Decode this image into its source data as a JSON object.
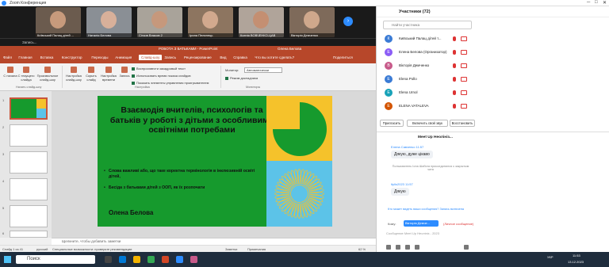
{
  "window": {
    "title": "Zoom Конференция"
  },
  "participants_stripe": [
    {
      "name": "Київський Палац дітей ...",
      "face": "#c79a7c",
      "bg": "#6b5b4e"
    },
    {
      "name": "Наталія Белова",
      "face": "#d8b09a",
      "bg": "#8a8f95"
    },
    {
      "name": "Сітков Власов 2",
      "face": "#c6987c",
      "bg": "#a9a39a"
    },
    {
      "name": "Ірина Пелипець",
      "face": "#d2a98e",
      "bg": "#8d7560"
    },
    {
      "name": "Ксенія ВОВЧЕНКО-ЦАВ",
      "face": "#c48f72",
      "bg": "#b0a49a"
    },
    {
      "name": "Вікторія Демченко",
      "face": "#cfa88c",
      "bg": "#7e6a5a"
    }
  ],
  "share": {
    "label": "Запись..."
  },
  "ppt": {
    "doc_title": "РОБОТА З БАТЬКАМИ - PowerPoint",
    "user": "Олена Белова",
    "share_btn": "Поделиться",
    "tabs": [
      "Файл",
      "Главная",
      "Вставка",
      "Конструктор",
      "Переходы",
      "Анимация",
      "Слайд-шоу",
      "Запись",
      "Рецензирование",
      "Вид",
      "Справка",
      "Что вы хотите сделать?"
    ],
    "active_tab": "Слайд-шоу",
    "ribbon": {
      "btn_start": "С начала",
      "btn_current": "С текущего слайда",
      "btn_custom": "Произвольное слайд-шоу",
      "group1": "Начать слайд-шоу",
      "btn_setup": "Настройка слайд-шоу",
      "btn_hide": "Скрыть слайд",
      "btn_rehearse": "Настройка времени",
      "btn_record": "Запись",
      "chk1": "Воспроизвести закадровый текст",
      "chk2": "Использовать время показа слайдов",
      "chk3": "Показать элементы управления проигрывателем",
      "group2": "Настройка",
      "monitor_label": "Монитор:",
      "monitor_value": "Автоматически",
      "presenter": "Режим докладчика",
      "group3": "Мониторы"
    },
    "slide": {
      "title": "Взаємодія вчителів, психологів та батьків у роботі з дітьми з особливими освітніми потребами",
      "bullets": [
        "Слова важливі або, що таке коректна термінологія в інклюзивній освіті дітей,",
        "Бесіда з батьками дітей з ООП, як їх розпочати"
      ],
      "author": "Олена Белова",
      "green": "#169a2d",
      "yellow": "#f5c22b",
      "blue": "#5cc3e8"
    },
    "thumb_numbers": [
      "1",
      "2",
      "3",
      "4",
      "5",
      "6"
    ],
    "notes_placeholder": "Щелкните, чтобы добавить заметки",
    "status": {
      "slide": "Слайд 1 из 41",
      "lang": "русский",
      "accessibility": "Специальные возможности: проверьте рекомендации",
      "notes": "Заметки",
      "comments": "Примечания",
      "zoom": "62 %"
    }
  },
  "panel": {
    "title": "Участники (72)",
    "search_placeholder": "Найти участника",
    "people": [
      {
        "initial": "К",
        "name": "Київський Палац дітей т...",
        "color": "#3a7bd5"
      },
      {
        "initial": "Е",
        "name": "Елена Белова (Организатор)",
        "color": "#8b5cf6"
      },
      {
        "initial": "В",
        "name": "Вікторія Демченко",
        "color": "#c75a8a"
      },
      {
        "initial": "E",
        "name": "Elena Pollo",
        "color": "#3a7bd5"
      },
      {
        "initial": "E",
        "name": "Elena Urnol",
        "color": "#17a2b8"
      },
      {
        "initial": "E",
        "name": "ELENA VATALEVA",
        "color": "#d35400"
      }
    ],
    "btn_invite": "Пригласить",
    "btn_unmute": "Включить свой звук",
    "btn_restore": "Восстановить",
    "chat_title": "Meet Up Неолініз...",
    "messages": [
      {
        "from": "Елена Савченко",
        "time": "11:57",
        "text": "Дякую, дуже цікаво"
      },
      {
        "system": "Пользователь Іона Шабога присоединился к закрытым чата"
      },
      {
        "from": "ltyllo2023",
        "time": "11:57",
        "text": "Дякую"
      }
    ],
    "privacy_note": "Кто может видеть ваши сообщения? Запись включена",
    "to_label": "Кому:",
    "to_value": "Вікторія Демче...",
    "to_note": "(Личное сообщение)",
    "input_placeholder": "Сообщение Meet Up Неолініз - 2023"
  },
  "taskbar": {
    "search": "Поиск",
    "lang": "УКР",
    "time": "11:53",
    "date": "13.12.2023"
  }
}
